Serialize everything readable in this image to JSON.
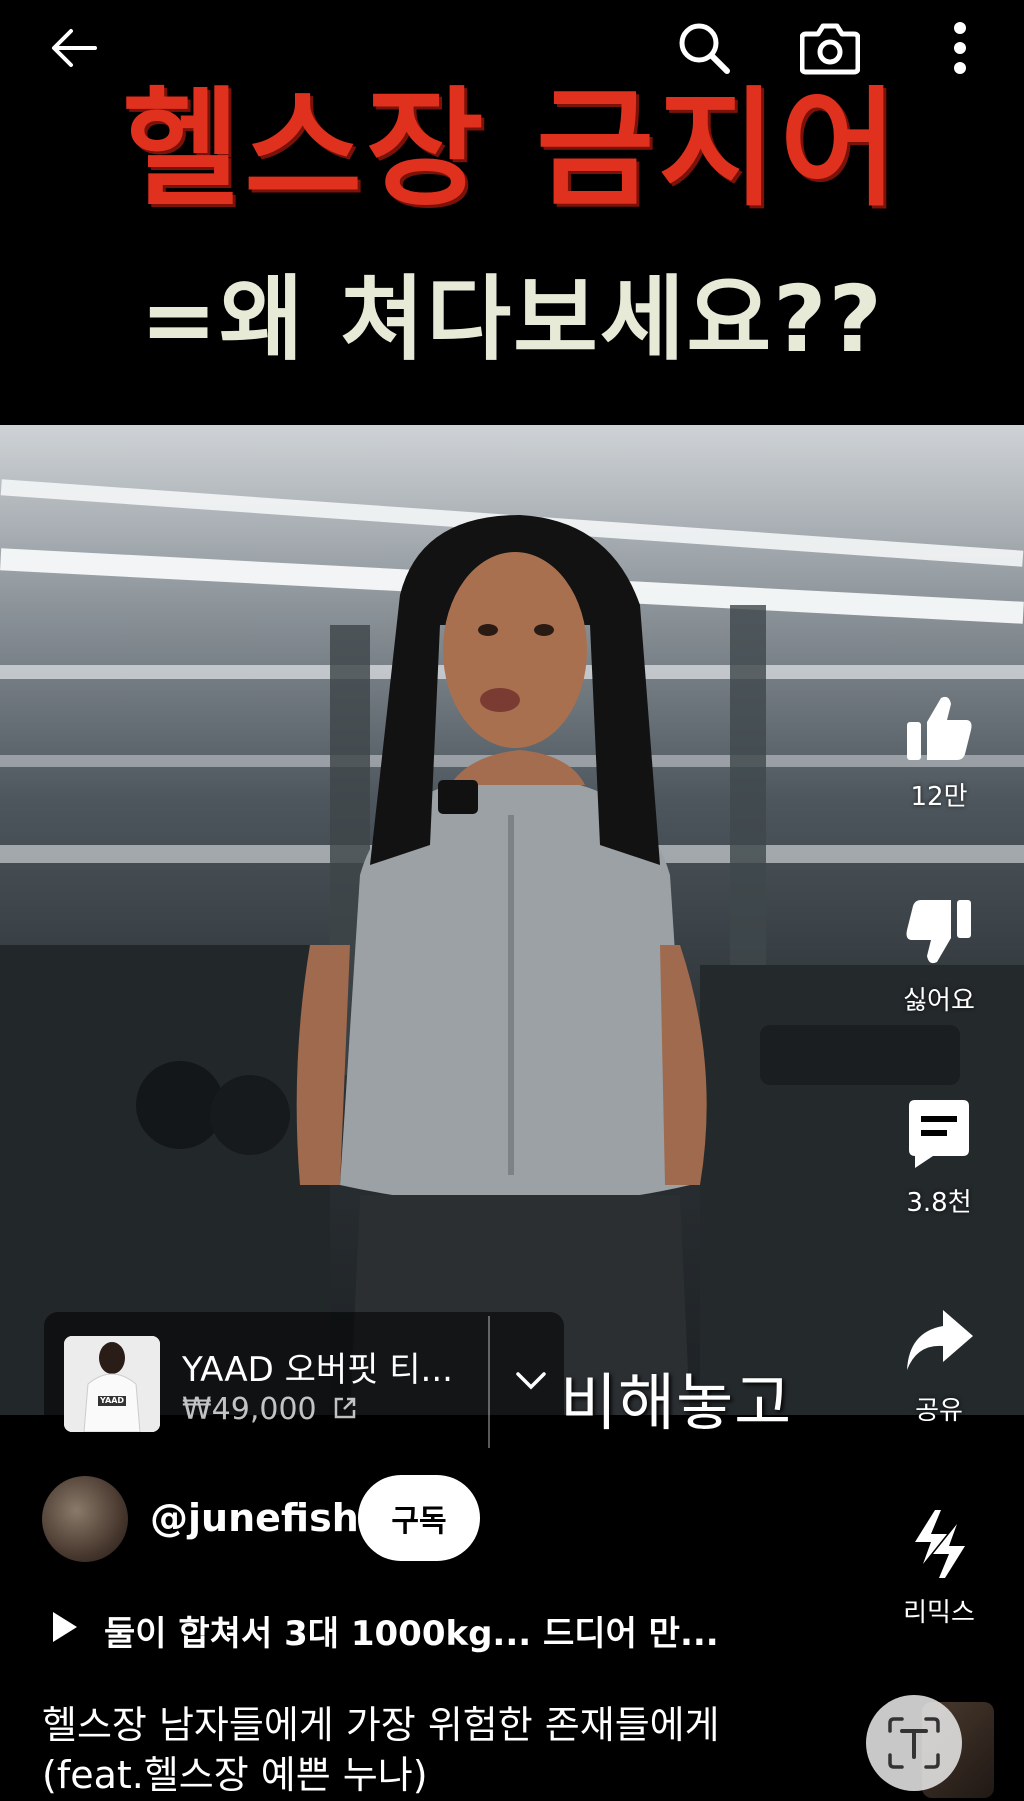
{
  "title_overlay": {
    "line1": "헬스장 금지어",
    "line2": "=왜 쳐다보세요??"
  },
  "top_bar": {
    "back_icon": "arrow-left-icon",
    "search_icon": "search-icon",
    "camera_icon": "camera-icon",
    "more_icon": "more-vertical-icon"
  },
  "actions": {
    "like": {
      "label": "12만",
      "icon": "thumbs-up-icon"
    },
    "dislike": {
      "label": "싫어요",
      "icon": "thumbs-down-icon"
    },
    "comments": {
      "label": "3.8천",
      "icon": "comment-icon"
    },
    "share": {
      "label": "공유",
      "icon": "share-icon"
    },
    "remix": {
      "label": "리믹스",
      "icon": "remix-icon"
    }
  },
  "product": {
    "name": "YAAD 오버핏 티...",
    "price": "₩49,000",
    "thumb_text": "YAAD"
  },
  "caption": "비해놓고",
  "channel": {
    "handle": "@junefishh",
    "subscribe_label": "구독"
  },
  "related": {
    "title": "둘이 합쳐서 3대 1000kg... 드디어 만..."
  },
  "description": {
    "line1": "헬스장 남자들에게 가장 위험한 존재들에게",
    "line2": "(feat.헬스장 예쁜 누나)"
  },
  "colors": {
    "title_red": "#e0301e",
    "title_cream": "#e8ead8",
    "background": "#000000"
  }
}
